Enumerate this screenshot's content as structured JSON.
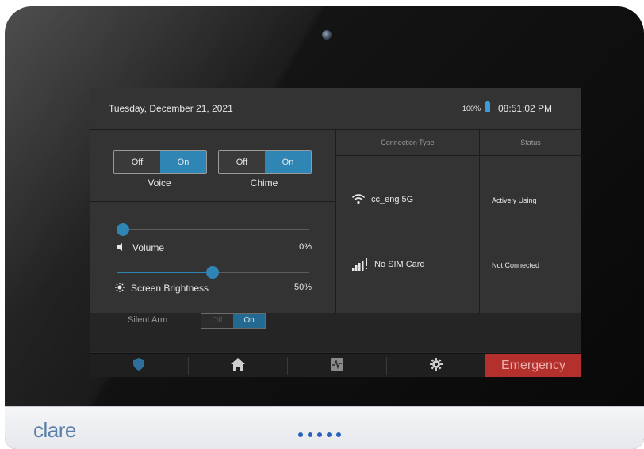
{
  "device": {
    "brand": "clare"
  },
  "statusbar": {
    "date": "Tuesday, December 21, 2021",
    "battery": "100%",
    "time": "08:51:02 PM"
  },
  "toggles": [
    {
      "label": "Voice",
      "off": "Off",
      "on": "On",
      "state": "on"
    },
    {
      "label": "Chime",
      "off": "Off",
      "on": "On",
      "state": "on"
    }
  ],
  "sliders": {
    "volume": {
      "label": "Volume",
      "value": "0%",
      "level": 0
    },
    "brightness": {
      "label": "Screen Brightness",
      "value": "50%",
      "level": 0.5
    }
  },
  "connection": {
    "headers": {
      "type": "Connection Type",
      "status": "Status"
    },
    "rows": [
      {
        "type": "cc_eng 5G",
        "icon": "wifi-icon",
        "status": "Actively Using"
      },
      {
        "type": "No SIM Card",
        "icon": "cellular-signal-icon",
        "status": "Not Connected"
      }
    ]
  },
  "silent_arm": {
    "label": "Silent Arm",
    "off": "Off",
    "on": "On"
  },
  "nav": {
    "items": [
      {
        "icon": "shield-icon"
      },
      {
        "icon": "home-icon"
      },
      {
        "icon": "activity-icon"
      },
      {
        "icon": "gear-icon"
      }
    ],
    "emergency": "Emergency"
  },
  "colors": {
    "accent": "#2f86b4",
    "emergency": "#b3302c",
    "brand": "#5a7fa8"
  }
}
